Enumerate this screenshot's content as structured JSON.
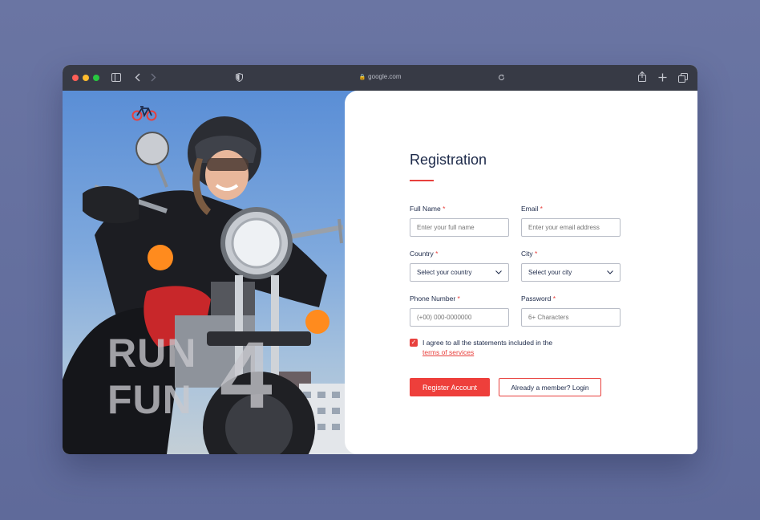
{
  "browser": {
    "url": "google.com",
    "traffic_colors": [
      "#ff5f57",
      "#febc2e",
      "#28c840"
    ]
  },
  "hero": {
    "word_top": "RUN",
    "word_bottom": "FUN",
    "numeral": "4",
    "logo_icon": "bicycle-icon"
  },
  "form": {
    "title": "Registration",
    "required_mark": "*",
    "full_name": {
      "label": "Full Name",
      "placeholder": "Enter your full name"
    },
    "email": {
      "label": "Email",
      "placeholder": "Enter your email address"
    },
    "country": {
      "label": "Country",
      "value": "Select your country"
    },
    "city": {
      "label": "City",
      "value": "Select your city"
    },
    "phone": {
      "label": "Phone Number",
      "placeholder": "(+00) 000-0000000"
    },
    "password": {
      "label": "Password",
      "placeholder": "6+ Characters"
    },
    "agree_text": "I agree to all the statements included in the",
    "terms_link": "terms of services",
    "register_label": "Register Account",
    "login_label": "Already a member? Login"
  },
  "colors": {
    "accent": "#ee3f3b",
    "heading": "#1d2a4a",
    "titlebar": "#373a45"
  }
}
